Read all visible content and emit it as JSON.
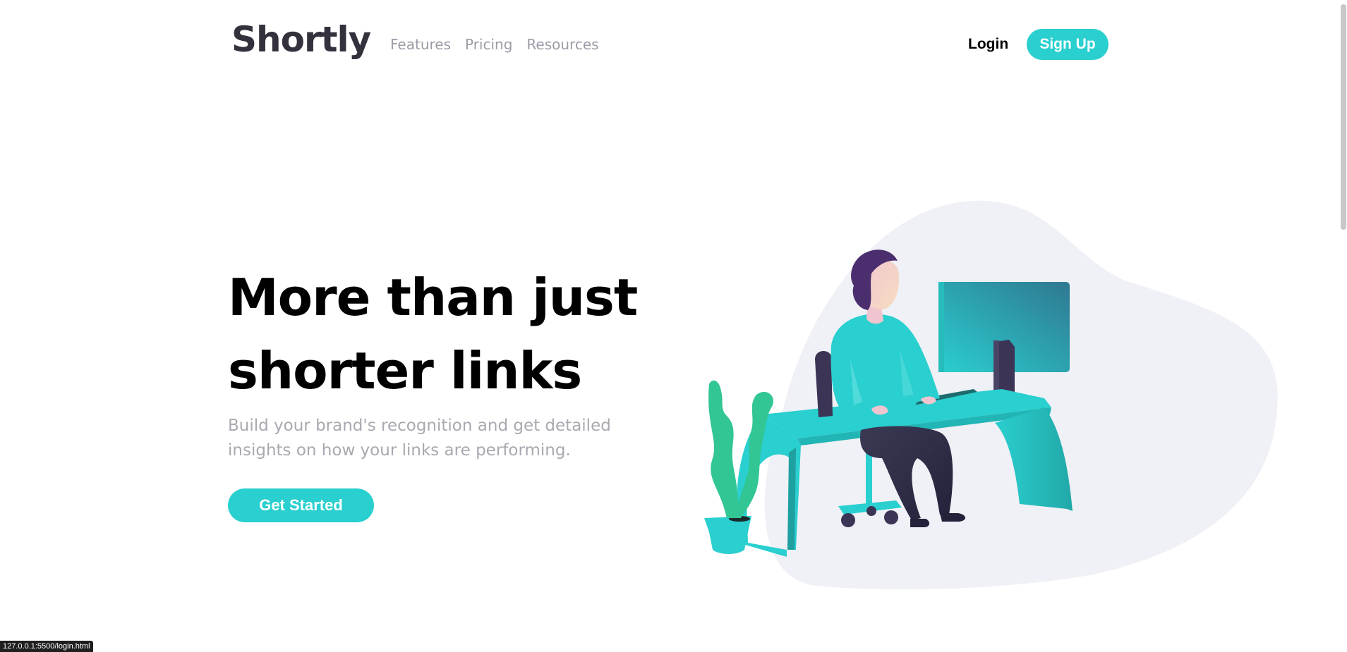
{
  "header": {
    "logo": "Shortly",
    "nav": [
      "Features",
      "Pricing",
      "Resources"
    ],
    "login_label": "Login",
    "signup_label": "Sign Up"
  },
  "hero": {
    "title_line1": "More than just",
    "title_line2": "shorter links",
    "subtitle": "Build your brand's recognition and get detailed insights on how your links are performing.",
    "cta_label": "Get Started"
  },
  "status_bar": {
    "url": "127.0.0.1:5500/login.html"
  },
  "colors": {
    "primary": "#2acfcf",
    "logo": "#34313d",
    "nav_text": "#9e9aa7",
    "subtitle_text": "#aaa8b0",
    "blob": "#f0f1f6"
  },
  "icons": {
    "illustration": "person-working-illustration"
  }
}
